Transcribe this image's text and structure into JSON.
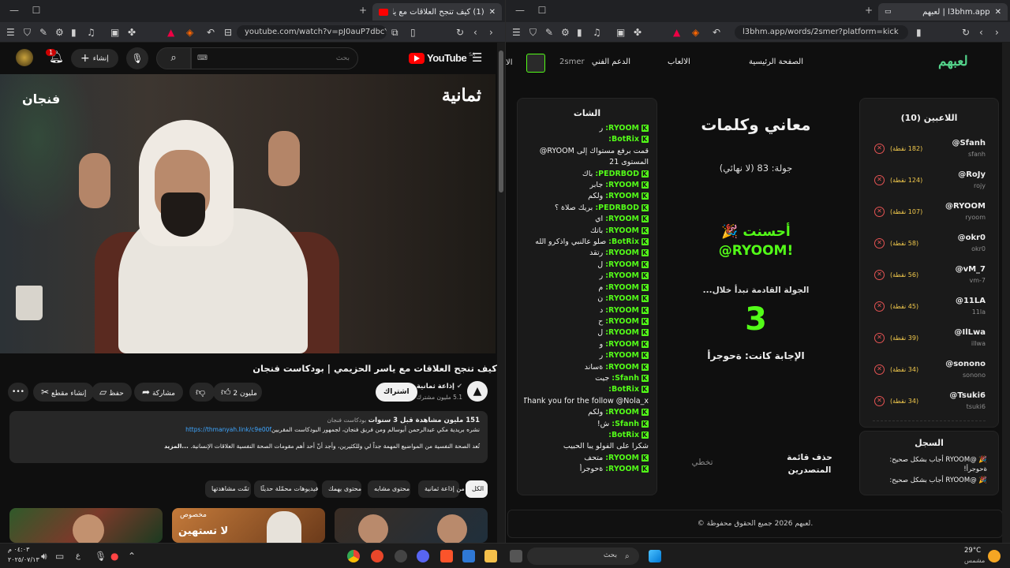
{
  "left": {
    "tab_title": "(1) كيف تنجح العلاقات مع ياسر ...",
    "url": "youtube.com/watch?v=pJ0auP7dbcY&t=8...",
    "yt": {
      "logo": "YouTube",
      "logo_sup": "SA",
      "search_placeholder": "بحث",
      "create_label": "إنشاء",
      "notif_count": "1"
    },
    "video_overlay_right": "ثمانية",
    "video_overlay_left": "فنجان",
    "title": "كيف تنجح العلاقات مع ياسر الحزيمي | بودكاست فنجان",
    "channel": "إذاعة ثمانية",
    "subs": "5.1 مليون مشترك",
    "subscribe": "اشتراك",
    "likes": "2 مليون",
    "share": "مشاركة",
    "save": "حفظ",
    "clip": "إنشاء مقطع",
    "more": "•••",
    "desc_line1": "151 مليون مشاهدة قبل 3 سنوات",
    "desc_tag": "بودكاست فنجان",
    "desc_line2": "نشره بريدية مكي عبدالرحمن أبوسالم ومن فريق فنجان، لجمهور البودكاست المقربين",
    "desc_link": "https://thmanyah.link/c9e00f",
    "desc_line3": "تُعد الصحة النفسية من المواضيع المهمة جداً لي وللكثيرين، وأجد أنّ أحد أهم مقومات الصحة النفسية العلاقات الإنسانية.",
    "desc_more": "...المزيد",
    "chips": [
      "الكل",
      "من إذاعة ثمانية",
      "محتوى مشابه",
      "محتوى يهمك",
      "فيديوهات محمّلة حديثًا",
      "تمّت مشاهدتها"
    ],
    "thumb_text": "لا تستهين",
    "thumb_tag": "مخصوص"
  },
  "right": {
    "tab_title": "l3bhm.app | لعبهم",
    "url": "l3bhm.app/words/2smer?platform=kick",
    "logo": "لعبهم",
    "nav": [
      "الصفحة الرئيسية",
      "الالعاب",
      "الدعم الفني",
      "الا"
    ],
    "user": "2smer",
    "players_title": "اللاعبين (10)",
    "players": [
      {
        "name": "Sfanh@",
        "handle": "sfanh",
        "score": "(182 نقطة)"
      },
      {
        "name": "RoJy@",
        "handle": "rojy",
        "score": "(124 نقطة)"
      },
      {
        "name": "RYOOM@",
        "handle": "ryoom",
        "score": "(107 نقطة)"
      },
      {
        "name": "okr0@",
        "handle": "okr0",
        "score": "(58 نقطة)"
      },
      {
        "name": "vM_7@",
        "handle": "vm-7",
        "score": "(56 نقطة)"
      },
      {
        "name": "11LA@",
        "handle": "11la",
        "score": "(45 نقطة)"
      },
      {
        "name": "IlLwa@",
        "handle": "illwa",
        "score": "(39 نقطة)"
      },
      {
        "name": "sonono@",
        "handle": "sonono",
        "score": "(34 نقطة)"
      },
      {
        "name": "Tsuki6@",
        "handle": "tsuki6",
        "score": "(34 نقطة)"
      }
    ],
    "log_title": "السجل",
    "log": [
      "🎉 @RYOOM أجاب بشكل صحيح: ةحوجرأ!",
      "🎉 @RYOOM أجاب بشكل صحيح:"
    ],
    "game_title": "معاني وكلمات",
    "round": "جولة: 83 (لا نهائي)",
    "bravo": "أحسنت 🎉",
    "bravo_user": "!RYOOM@",
    "next_round": "الجولة القادمة تبدأ خلال...",
    "countdown": "3",
    "answer": "الإجابة كانت: ةحوجرأ",
    "delete_leaderboard": "حذف قائمة المتصدرين",
    "skip": "تخطي",
    "chat_title": "الشات",
    "chat": [
      {
        "u": "RYOOM",
        "m": "ر"
      },
      {
        "u": "BotRix",
        "m": ""
      },
      {
        "u": "",
        "m": "قمت برفع مستواك إلى RYOOM@"
      },
      {
        "u": "",
        "m": "المستوى 21"
      },
      {
        "u": "PEDRBOD",
        "m": "باك"
      },
      {
        "u": "RYOOM",
        "m": "جابر"
      },
      {
        "u": "RYOOM",
        "m": "ولكم"
      },
      {
        "u": "PEDRBOD",
        "m": "بريك صلاة ؟"
      },
      {
        "u": "RYOOM",
        "m": "اي"
      },
      {
        "u": "RYOOM",
        "m": "باتك"
      },
      {
        "u": "BotRix",
        "m": "صلو عالنبي واذكرو الله"
      },
      {
        "u": "RYOOM",
        "m": "رتقد"
      },
      {
        "u": "RYOOM",
        "m": "ل"
      },
      {
        "u": "RYOOM",
        "m": "ر"
      },
      {
        "u": "RYOOM",
        "m": "م"
      },
      {
        "u": "RYOOM",
        "m": "ن"
      },
      {
        "u": "RYOOM",
        "m": "د"
      },
      {
        "u": "RYOOM",
        "m": "ح"
      },
      {
        "u": "RYOOM",
        "m": "ل"
      },
      {
        "u": "RYOOM",
        "m": "و"
      },
      {
        "u": "RYOOM",
        "m": "ر"
      },
      {
        "u": "RYOOM",
        "m": "ةساند"
      },
      {
        "u": "Sfanh",
        "m": "جيت"
      },
      {
        "u": "BotRix",
        "m": ""
      },
      {
        "u": "",
        "m": "Thank you for the follow @Nola_x"
      },
      {
        "u": "RYOOM",
        "m": "ولكم"
      },
      {
        "u": "Sfanh",
        "m": "ش!"
      },
      {
        "u": "BotRix",
        "m": ""
      },
      {
        "u": "",
        "m": "شكرا على الفولو يبا الحبيب"
      },
      {
        "u": "RYOOM",
        "m": "متحف"
      },
      {
        "u": "RYOOM",
        "m": "ةحوجرأ"
      }
    ],
    "footer": "© لعبهم 2026 جميع الحقوق محفوظة."
  },
  "taskbar": {
    "time": "٠٤:٠٣ م",
    "date": "٢٠٢٥/٠٧/١٣",
    "lang": "ع",
    "search": "بحث",
    "temp": "29°C",
    "weather": "مشمس"
  }
}
